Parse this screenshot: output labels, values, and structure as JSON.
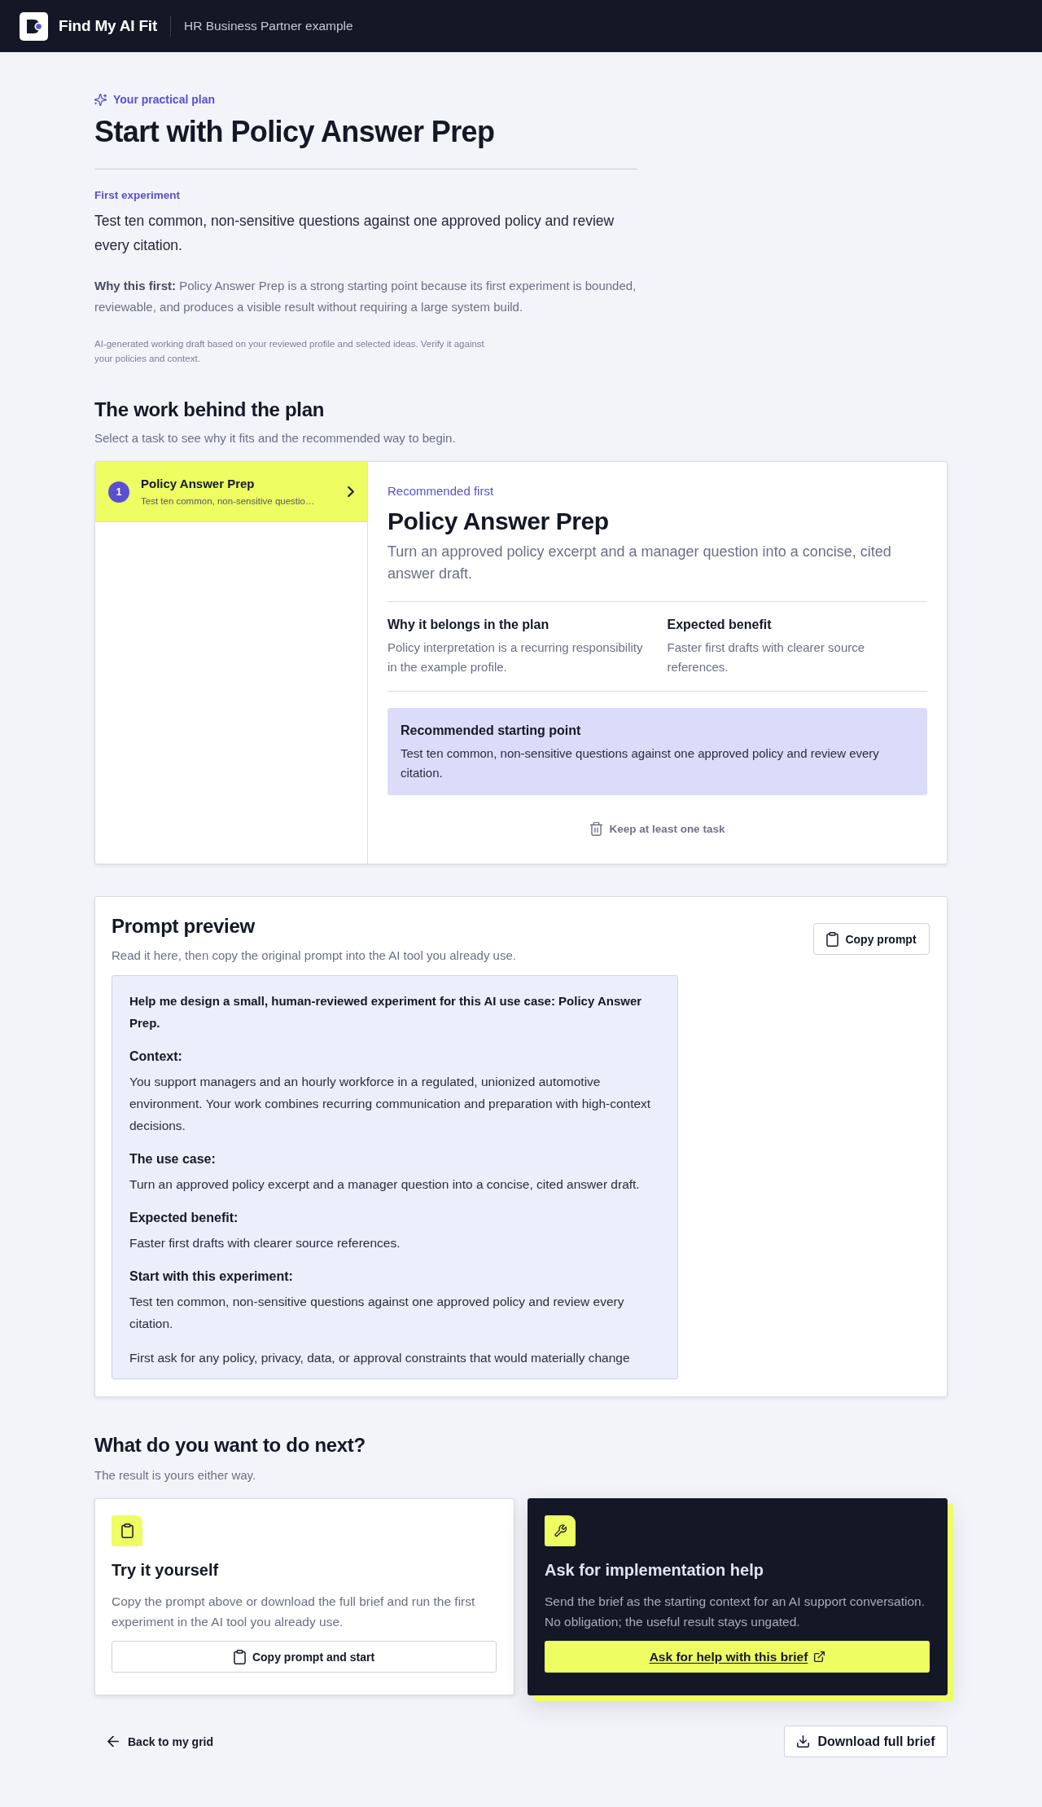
{
  "header": {
    "brand": "Find My AI Fit",
    "context": "HR Business Partner example"
  },
  "plan": {
    "eyebrow": "Your practical plan",
    "title": "Start with Policy Answer Prep",
    "experiment_label": "First experiment",
    "experiment": "Test ten common, non-sensitive questions against one approved policy and review every citation.",
    "why_first": "**Why this first:** Policy Answer Prep is a strong starting point because its first experiment is bounded, reviewable, and produces a visible result without requiring a large system build.",
    "disclaimer": "AI-generated working draft based on your reviewed profile and selected ideas. Verify it against your policies and context."
  },
  "work": {
    "title": "The work behind the plan",
    "subtitle": "Select a task to see why it fits and the recommended way to begin.",
    "tasks": [
      {
        "number": "1",
        "title": "Policy Answer Prep",
        "summary": "Test ten common, non-sensitive questio…",
        "selected": true
      }
    ],
    "detail": {
      "eyebrow": "Recommended first",
      "title": "Policy Answer Prep",
      "description": "Turn an approved policy excerpt and a manager question into a concise, cited answer draft.",
      "columns": [
        {
          "heading": "Why it belongs in the plan",
          "text": "Policy interpretation is a recurring responsibility in the example profile."
        },
        {
          "heading": "Expected benefit",
          "text": "Faster first drafts with clearer source references."
        }
      ],
      "callout": {
        "heading": "Recommended starting point",
        "text": "Test ten common, non-sensitive questions against one approved policy and review every citation."
      },
      "remove_action": {
        "label": "Keep at least one task",
        "disabled": true
      }
    }
  },
  "prompt": {
    "title": "Prompt preview",
    "subtitle": "Read it here, then copy the original prompt into the AI tool you already use.",
    "copy_button": "Copy prompt",
    "blocks": [
      {
        "kind": "lead",
        "text": "Help me design a small, human-reviewed experiment for this AI use case: Policy Answer Prep."
      },
      {
        "kind": "heading",
        "text": "Context:"
      },
      {
        "kind": "paragraph",
        "text": "You support managers and an hourly workforce in a regulated, unionized automotive environment. Your work combines recurring communication and preparation with high-context decisions."
      },
      {
        "kind": "heading",
        "text": "The use case:"
      },
      {
        "kind": "paragraph",
        "text": "Turn an approved policy excerpt and a manager question into a concise, cited answer draft."
      },
      {
        "kind": "heading",
        "text": "Expected benefit:"
      },
      {
        "kind": "paragraph",
        "text": "Faster first drafts with clearer source references."
      },
      {
        "kind": "heading",
        "text": "Start with this experiment:"
      },
      {
        "kind": "paragraph",
        "text": "Test ten common, non-sensitive questions against one approved policy and review every citation."
      },
      {
        "kind": "paragraph",
        "text": "First ask for any policy, privacy, data, or approval constraints that would materially change"
      }
    ]
  },
  "next": {
    "title": "What do you want to do next?",
    "subtitle": "The result is yours either way.",
    "options": [
      {
        "kind": "self",
        "title": "Try it yourself",
        "text": "Copy the prompt above or download the full brief and run the first experiment in the AI tool you already use.",
        "button": "Copy prompt and start"
      },
      {
        "kind": "assisted",
        "title": "Ask for implementation help",
        "text": "Send the brief as the starting context for an AI support conversation. No obligation; the useful result stays ungated.",
        "button": "Ask for help with this brief"
      }
    ]
  },
  "footer": {
    "back_link": "Back to my grid",
    "download_button": "Download full brief"
  }
}
